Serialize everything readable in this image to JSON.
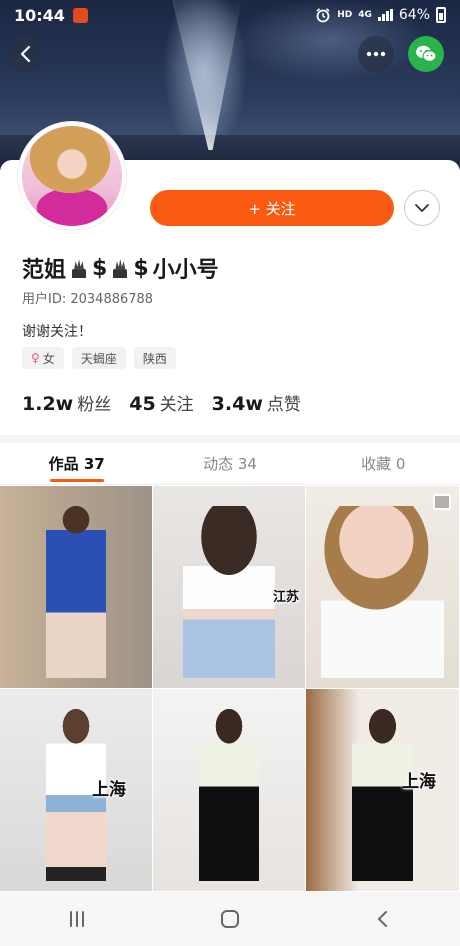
{
  "status_bar": {
    "time": "10:44",
    "hd": "HD",
    "network": "4G",
    "battery": "64%"
  },
  "profile": {
    "follow_label": "+ 关注",
    "name_part1": "范姐",
    "name_dollar1": "$",
    "name_dollar2": "$",
    "name_part2": "小小号",
    "user_id": "用户ID: 2034886788",
    "bio": "谢谢关注！",
    "tags": {
      "gender_symbol": "♀",
      "gender": "女",
      "zodiac": "天蝎座",
      "region": "陕西"
    },
    "stats": {
      "fans_num": "1.2w",
      "fans_label": "粉丝",
      "following_num": "45",
      "following_label": "关注",
      "likes_num": "3.4w",
      "likes_label": "点赞"
    }
  },
  "tabs": {
    "works": "作品 37",
    "moments": "动态 34",
    "favorites": "收藏 0"
  },
  "grid": {
    "tile2_caption": "江苏",
    "tile4_caption": "上海",
    "tile6_caption": "上海"
  },
  "colors": {
    "accent": "#fb5a12",
    "wechat": "#29b34a"
  },
  "icons": [
    "back-arrow-icon",
    "more-dots-icon",
    "wechat-icon",
    "chevron-down-icon",
    "gallery-icon",
    "recent-apps-icon",
    "home-icon",
    "back-icon"
  ]
}
